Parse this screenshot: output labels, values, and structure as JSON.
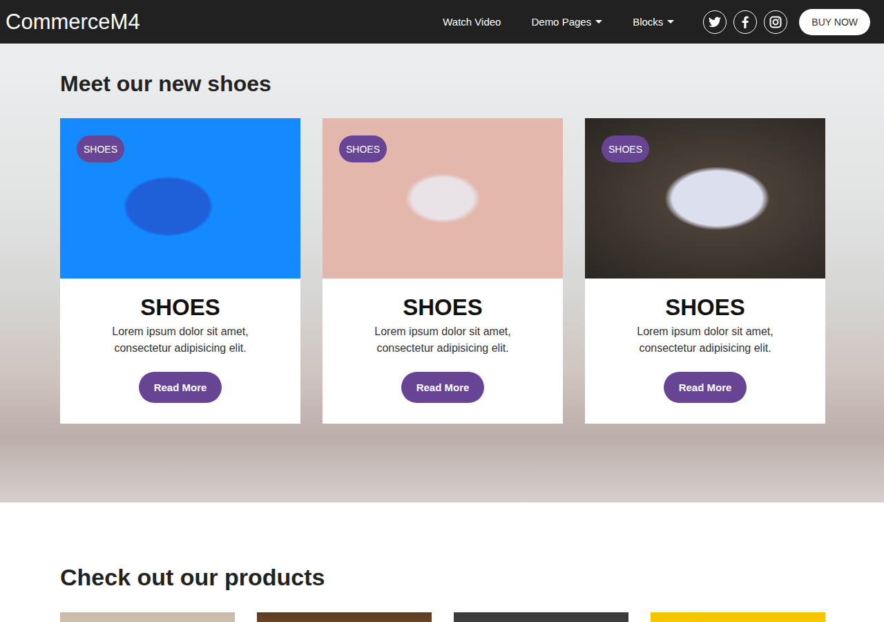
{
  "nav": {
    "logo": "CommerceM4",
    "links": [
      {
        "label": "Watch Video",
        "dropdown": false
      },
      {
        "label": "Demo Pages",
        "dropdown": true
      },
      {
        "label": "Blocks",
        "dropdown": true
      }
    ],
    "buy_button": "BUY NOW"
  },
  "hero": {
    "title": "Meet our new shoes",
    "cards": [
      {
        "badge": "SHOES",
        "title": "SHOES",
        "text": "Lorem ipsum dolor sit amet, consectetur adipisicing elit.",
        "button": "Read More"
      },
      {
        "badge": "SHOES",
        "title": "SHOES",
        "text": "Lorem ipsum dolor sit amet, consectetur adipisicing elit.",
        "button": "Read More"
      },
      {
        "badge": "SHOES",
        "title": "SHOES",
        "text": "Lorem ipsum dolor sit amet, consectetur adipisicing elit.",
        "button": "Read More"
      }
    ]
  },
  "products": {
    "title": "Check out our products"
  }
}
